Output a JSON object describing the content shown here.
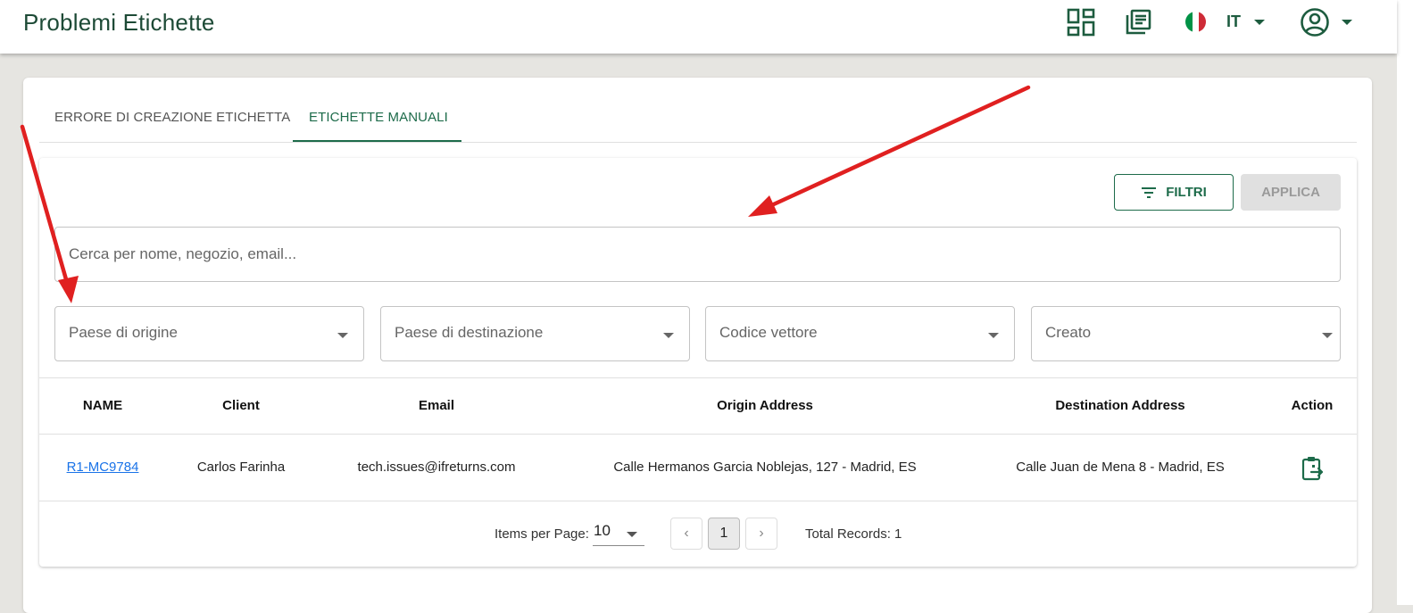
{
  "header": {
    "title": "Problemi Etichette",
    "language_code": "IT",
    "icons": [
      "dashboard-icon",
      "news-list-icon",
      "italy-flag-icon",
      "account-circle-icon"
    ],
    "flag_colors": [
      "#009246",
      "#ffffff",
      "#ce2b37"
    ]
  },
  "tabs": [
    {
      "label": "ERRORE DI CREAZIONE ETICHETTA",
      "active": false
    },
    {
      "label": "ETICHETTE MANUALI",
      "active": true
    }
  ],
  "filters": {
    "filtri_label": "FILTRI",
    "applica_label": "APPLICA",
    "search_placeholder": "Cerca per nome, negozio, email...",
    "selects": [
      {
        "placeholder": "Paese di origine"
      },
      {
        "placeholder": "Paese di destinazione"
      },
      {
        "placeholder": "Codice vettore"
      },
      {
        "placeholder": "Creato"
      }
    ]
  },
  "table": {
    "columns": [
      "NAME",
      "Client",
      "Email",
      "Origin Address",
      "Destination Address",
      "Action"
    ],
    "rows": [
      {
        "name": "R1-MC9784",
        "client": "Carlos Farinha",
        "email": "tech.issues@ifreturns.com",
        "origin": "Calle Hermanos Garcia Noblejas, 127 - Madrid, ES",
        "destination": "Calle Juan de Mena 8 - Madrid, ES",
        "action_icon": "clipboard-transfer-icon"
      }
    ]
  },
  "pagination": {
    "items_per_page_label": "Items per Page:",
    "items_per_page": "10",
    "prev_icon": "chevron-left-icon",
    "current_page": "1",
    "next_icon": "chevron-right-icon",
    "total_records": "Total Records: 1"
  },
  "colors": {
    "primary": "#1d6b4a",
    "title": "#1d4a36",
    "link": "#1a73e8",
    "annotation_arrow": "#e02020",
    "background": "#e6e5e1"
  }
}
